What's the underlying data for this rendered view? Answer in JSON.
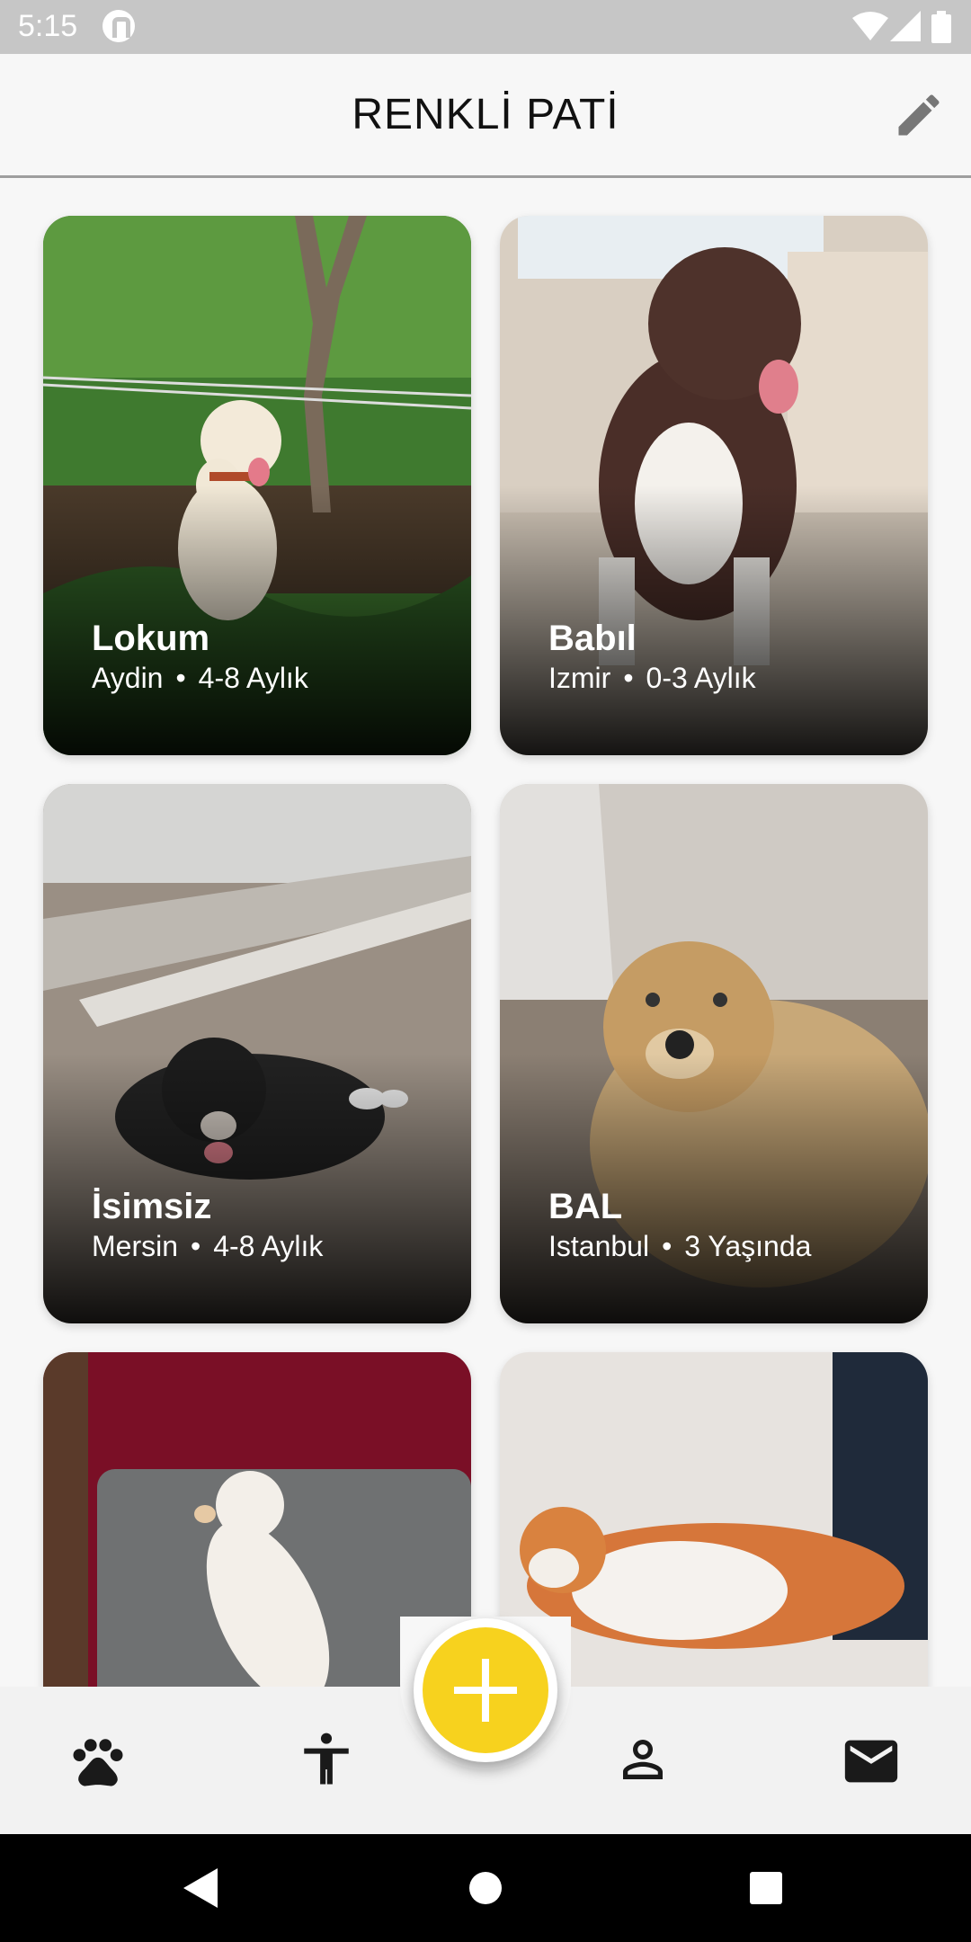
{
  "status_bar": {
    "time": "5:15"
  },
  "app_bar": {
    "title": "RENKLİ PATİ",
    "edit_icon": "pencil-icon"
  },
  "pets": [
    {
      "name": "Lokum",
      "city": "Aydin",
      "dot": "•",
      "age": "4-8 Aylık",
      "photo": "golden-puppy-on-grass"
    },
    {
      "name": "Babıl",
      "city": "Izmir",
      "dot": "•",
      "age": "0-3 Aylık",
      "photo": "brown-white-puppy-on-sofa"
    },
    {
      "name": "İsimsiz",
      "city": "Mersin",
      "dot": "•",
      "age": "4-8 Aylık",
      "photo": "black-puppy-on-ground"
    },
    {
      "name": "BAL",
      "city": "Istanbul",
      "dot": "•",
      "age": "3 Yaşında",
      "photo": "golden-dog-lying"
    },
    {
      "name": "",
      "city": "",
      "dot": "",
      "age": "",
      "photo": "white-kitten-on-sofa"
    },
    {
      "name": "",
      "city": "",
      "dot": "",
      "age": "",
      "photo": "orange-white-cat-sleeping"
    }
  ],
  "bottom_nav": {
    "items": [
      "paw-icon",
      "accessibility-icon",
      "add-icon",
      "person-icon",
      "mail-icon"
    ],
    "accent": "#f7d21e"
  },
  "system_nav": [
    "back-icon",
    "home-icon",
    "recents-icon"
  ]
}
